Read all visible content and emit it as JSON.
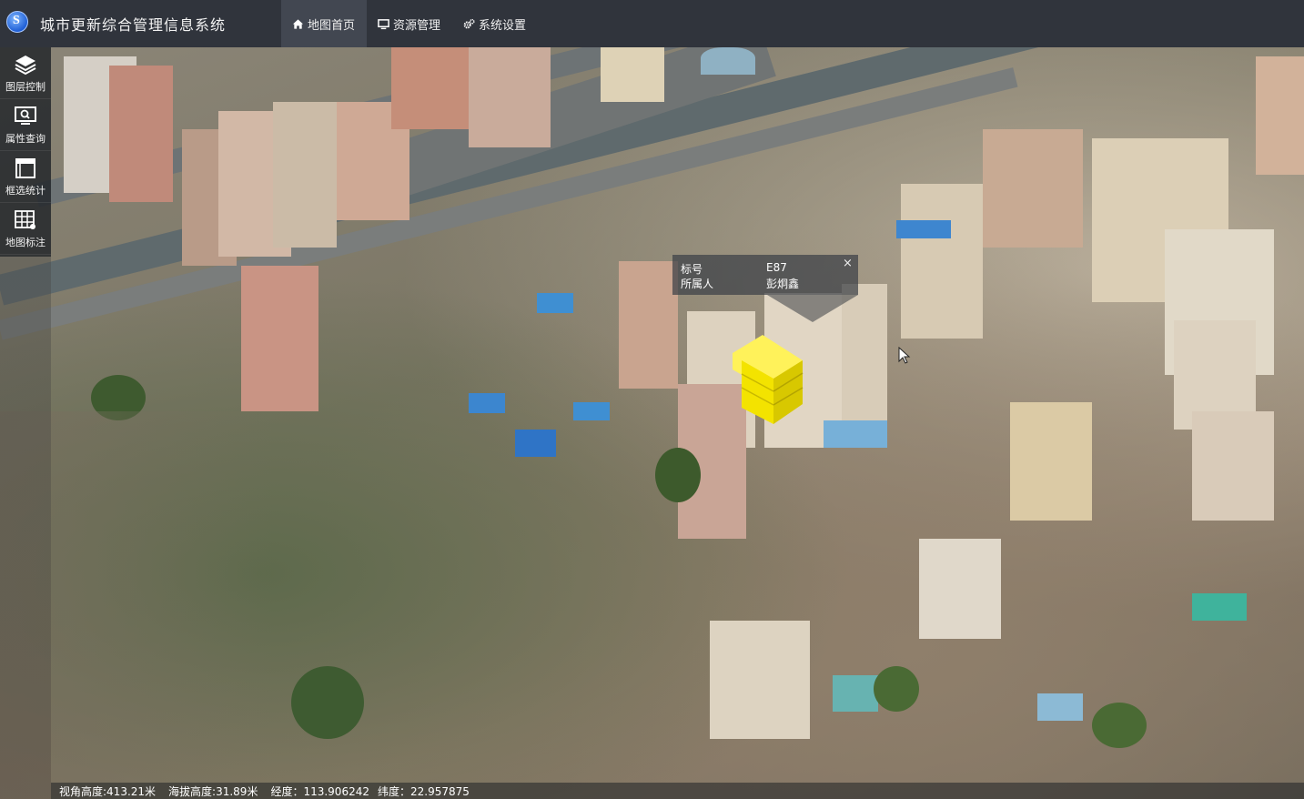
{
  "app": {
    "title": "城市更新综合管理信息系统"
  },
  "nav": [
    {
      "label": "地图首页",
      "icon": "home-icon",
      "active": true
    },
    {
      "label": "资源管理",
      "icon": "monitor-icon",
      "active": false
    },
    {
      "label": "系统设置",
      "icon": "gears-icon",
      "active": false
    }
  ],
  "sidebar": [
    {
      "label": "图层控制",
      "icon": "layers-icon"
    },
    {
      "label": "属性查询",
      "icon": "screen-search-icon"
    },
    {
      "label": "框选统计",
      "icon": "box-select-icon"
    },
    {
      "label": "地图标注",
      "icon": "grid-mark-icon"
    }
  ],
  "popup": {
    "field1_label": "标号",
    "field1_value": "E87",
    "field2_label": "所属人",
    "field2_value": "彭炯鑫",
    "close": "×"
  },
  "status": {
    "view_height": "视角高度:413.21米",
    "altitude": "海拔高度:31.89米",
    "longitude": "经度：113.906242",
    "latitude": "纬度：22.957875"
  },
  "colors": {
    "topbar": "#30343c",
    "active_tab": "#424751",
    "highlight": "#f5e600"
  }
}
